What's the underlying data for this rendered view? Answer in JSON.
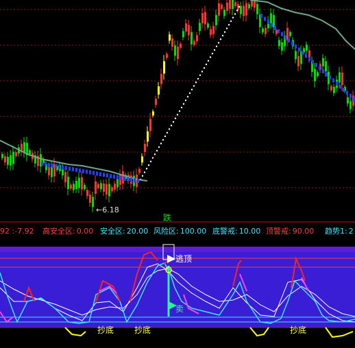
{
  "main_chart": {
    "min_price_label": "←6.18",
    "bottom_signal": "跌"
  },
  "indicator_bar": {
    "lead_value": "92 :-7.92",
    "items": [
      {
        "label": "高安全区:",
        "value": "0.00",
        "color": "#ff3b3b"
      },
      {
        "label": "安全区:",
        "value": "20.00",
        "color": "#39e6ff"
      },
      {
        "label": "风险区:",
        "value": "100.00",
        "color": "#39e6ff"
      },
      {
        "label": "底警戒:",
        "value": "10.00",
        "color": "#39e6ff"
      },
      {
        "label": "顶警戒:",
        "value": "90.00",
        "color": "#ff3b3b"
      },
      {
        "label": "趋势1:",
        "value": "2",
        "color": "#39e6ff"
      }
    ]
  },
  "sub_chart": {
    "signals": {
      "escape_top": "逃顶",
      "sell": "卖",
      "bottom_1": "抄底",
      "bottom_2": "抄底",
      "bottom_3": "抄底"
    }
  },
  "colors": {
    "background": "#000000",
    "grid": "#8b1a1a",
    "up": "#ff3030",
    "down": "#00e000",
    "indicator_bg": "#3a1ed6"
  }
}
